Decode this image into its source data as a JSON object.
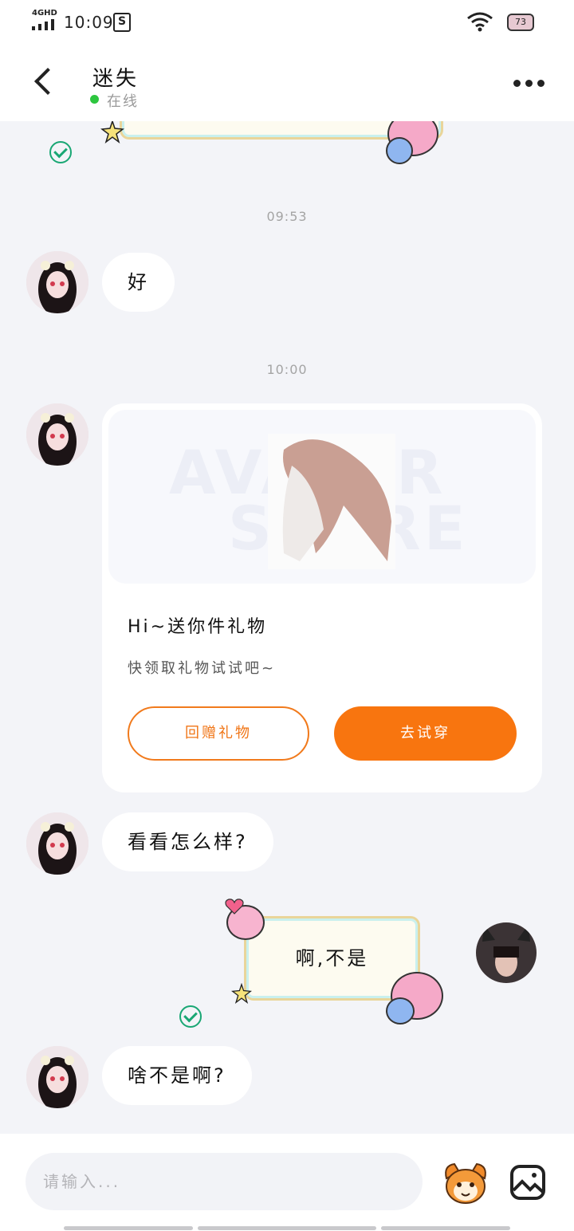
{
  "status_bar": {
    "network": "4GHD",
    "time": "10:09",
    "app_icon_letter": "S",
    "battery": "73"
  },
  "header": {
    "title": "迷失",
    "status_text": "在线"
  },
  "messages": {
    "time_1": "09:53",
    "msg_1": "好",
    "time_2": "10:00",
    "gift_card": {
      "watermark_1": "AVATAR",
      "watermark_2": "STORE",
      "title": "Hi~送你件礼物",
      "subtitle": "快领取礼物试试吧~",
      "button_return": "回赠礼物",
      "button_try": "去试穿"
    },
    "msg_2": "看看怎么样?",
    "msg_3_self": "啊,不是",
    "msg_4": "啥不是啊?"
  },
  "input_bar": {
    "placeholder": "请输入..."
  },
  "colors": {
    "accent_orange": "#f8750f",
    "online_green": "#2dc63f",
    "check_green": "#19a774"
  }
}
